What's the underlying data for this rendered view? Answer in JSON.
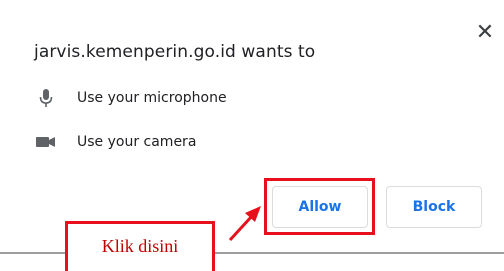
{
  "dialog": {
    "title": "jarvis.kemenperin.go.id wants to",
    "close_glyph": "✕",
    "permissions": [
      {
        "icon": "microphone-icon",
        "label": "Use your microphone"
      },
      {
        "icon": "camera-icon",
        "label": "Use your camera"
      }
    ],
    "buttons": {
      "allow": "Allow",
      "block": "Block"
    }
  },
  "annotation": {
    "callout_text": "Klik disini"
  },
  "colors": {
    "accent": "#1a73e8",
    "highlight": "#e8101c",
    "callout_text": "#c00000"
  }
}
